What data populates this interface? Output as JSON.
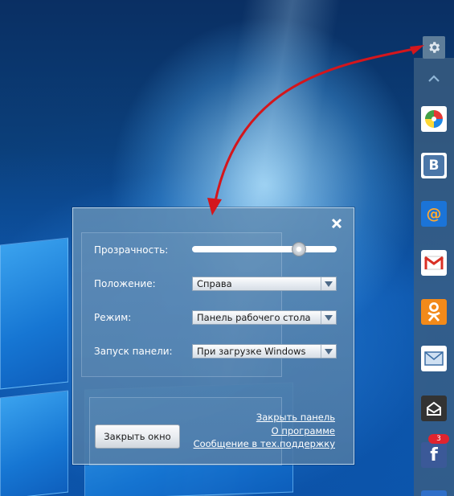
{
  "dialog": {
    "close_icon": "close-icon",
    "transparency": {
      "label": "Прозрачность:",
      "value_fraction": 0.74
    },
    "position": {
      "label": "Положение:",
      "value": "Справа"
    },
    "mode": {
      "label": "Режим:",
      "value": "Панель рабочего стола"
    },
    "startup": {
      "label": "Запуск панели:",
      "value": "При загрузке Windows"
    },
    "close_window_button": "Закрыть окно",
    "links": [
      "Закрыть панель",
      "О программе",
      "Сообщение в тех.поддержку"
    ]
  },
  "side_panel": {
    "settings_icon": "gear-icon",
    "collapse_icon": "chevron-up-icon",
    "apps": [
      {
        "name": "pinwheel-app-icon",
        "color": "#ffffff"
      },
      {
        "name": "vk-icon",
        "glyph": "B",
        "color": "#ffffff"
      },
      {
        "name": "mail-ru-icon",
        "glyph": "@",
        "color": "#1b74d8"
      },
      {
        "name": "gmail-icon",
        "glyph": "M",
        "color": "#ffffff"
      },
      {
        "name": "odnoklassniki-icon",
        "color": "#f28a1a"
      },
      {
        "name": "mail-envelope-icon",
        "color": "#ffffff"
      },
      {
        "name": "mail-inbox-icon",
        "color": "#333333"
      },
      {
        "name": "facebook-icon",
        "glyph": "f",
        "color": "#3b5998",
        "badge": "3"
      }
    ]
  },
  "colors": {
    "arrow": "#d4161c",
    "dialog_bg": "#5f8cb4",
    "side_panel_bg": "#3c5f82",
    "notification_badge": "#e0242e"
  }
}
